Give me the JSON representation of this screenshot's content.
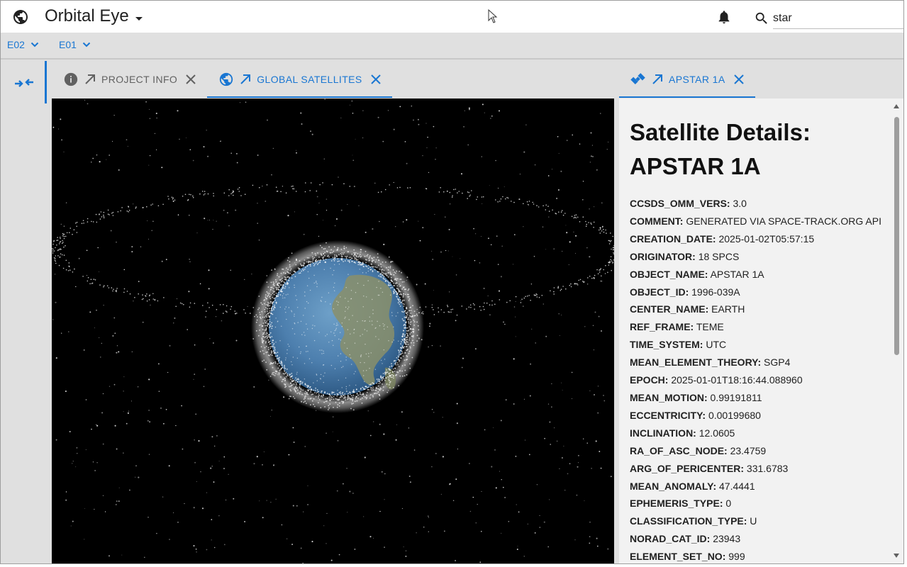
{
  "app": {
    "title": "Orbital Eye",
    "search_value": "star",
    "search_placeholder": ""
  },
  "subbar": {
    "dropdowns": [
      {
        "label": "E02"
      },
      {
        "label": "E01"
      }
    ]
  },
  "center_tabs": [
    {
      "label": "PROJECT INFO",
      "icon": "info-icon",
      "active": false
    },
    {
      "label": "GLOBAL SATELLITES",
      "icon": "globe-icon",
      "active": true
    }
  ],
  "right_tabs": [
    {
      "label": "APSTAR 1A",
      "icon": "satellite-icon",
      "active": true
    }
  ],
  "details": {
    "title": "Satellite Details: APSTAR 1A",
    "fields": [
      {
        "key": "CCSDS_OMM_VERS:",
        "value": "3.0"
      },
      {
        "key": "COMMENT:",
        "value": "GENERATED VIA SPACE-TRACK.ORG API"
      },
      {
        "key": "CREATION_DATE:",
        "value": "2025-01-02T05:57:15"
      },
      {
        "key": "ORIGINATOR:",
        "value": "18 SPCS"
      },
      {
        "key": "OBJECT_NAME:",
        "value": "APSTAR 1A"
      },
      {
        "key": "OBJECT_ID:",
        "value": "1996-039A"
      },
      {
        "key": "CENTER_NAME:",
        "value": "EARTH"
      },
      {
        "key": "REF_FRAME:",
        "value": "TEME"
      },
      {
        "key": "TIME_SYSTEM:",
        "value": "UTC"
      },
      {
        "key": "MEAN_ELEMENT_THEORY:",
        "value": "SGP4"
      },
      {
        "key": "EPOCH:",
        "value": "2025-01-01T18:16:44.088960"
      },
      {
        "key": "MEAN_MOTION:",
        "value": "0.99191811"
      },
      {
        "key": "ECCENTRICITY:",
        "value": "0.00199680"
      },
      {
        "key": "INCLINATION:",
        "value": "12.0605"
      },
      {
        "key": "RA_OF_ASC_NODE:",
        "value": "23.4759"
      },
      {
        "key": "ARG_OF_PERICENTER:",
        "value": "331.6783"
      },
      {
        "key": "MEAN_ANOMALY:",
        "value": "47.4441"
      },
      {
        "key": "EPHEMERIS_TYPE:",
        "value": "0"
      },
      {
        "key": "CLASSIFICATION_TYPE:",
        "value": "U"
      },
      {
        "key": "NORAD_CAT_ID:",
        "value": "23943"
      },
      {
        "key": "ELEMENT_SET_NO:",
        "value": "999"
      }
    ]
  },
  "colors": {
    "accent": "#1976d2",
    "panel_bg": "#e0e0e0",
    "detail_bg": "#f2f2f2",
    "space": "#000000"
  }
}
